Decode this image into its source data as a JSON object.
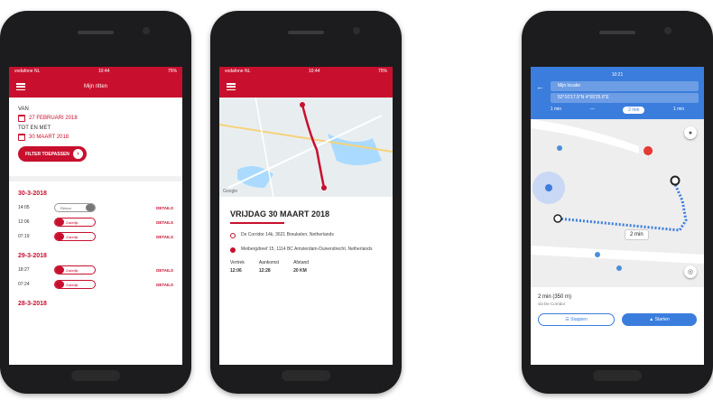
{
  "colors": {
    "brand_red": "#c8102e",
    "google_blue": "#3b7ddd"
  },
  "screen1": {
    "status_left": "vodafone NL",
    "status_time": "10:44",
    "status_right": "75%",
    "title": "Mijn ritten",
    "from_label": "VAN",
    "from_date": "27 FEBRUARI 2018",
    "to_label": "TOT EN MET",
    "to_date": "30 MAART 2018",
    "filter_button": "FILTER TOEPASSEN",
    "groups": [
      {
        "date": "30-3-2018",
        "rows": [
          {
            "time": "14:05",
            "toggle": "Retour",
            "detail": "DETAILS"
          },
          {
            "time": "12:06",
            "toggle": "Zakelijk",
            "detail": "DETAILS"
          },
          {
            "time": "07:19",
            "toggle": "Zakelijk",
            "detail": "DETAILS"
          }
        ]
      },
      {
        "date": "29-3-2018",
        "rows": [
          {
            "time": "18:27",
            "toggle": "Zakelijk",
            "detail": "DETAILS"
          },
          {
            "time": "07:24",
            "toggle": "Zakelijk",
            "detail": "DETAILS"
          }
        ]
      },
      {
        "date": "28-3-2018",
        "rows": []
      }
    ]
  },
  "screen2": {
    "status_left": "vodafone NL",
    "status_time": "10:44",
    "status_right": "75%",
    "map_brand": "Google",
    "heading": "VRIJDAG 30 MAART 2018",
    "from_address": "De Corridor 14k, 3621 Breukelen, Netherlands",
    "to_address": "Meibergdreef 15, 1114 BC Amsterdam-Duivendrecht, Netherlands",
    "stats": [
      {
        "label": "Vertrek",
        "value": "12:06"
      },
      {
        "label": "Aankomst",
        "value": "12:28"
      },
      {
        "label": "Afstand",
        "value": "20 KM"
      }
    ]
  },
  "screen3": {
    "status_time": "10:21",
    "origin": "Mijn locatie",
    "destination": "52°10'17.9\"N 4°59'25.6\"E",
    "modes": [
      "1 min",
      "—",
      "2 min",
      "1 min"
    ],
    "eta_bubble": "2 min",
    "summary": "2 min (350 m)",
    "summary_sub": "via De Corridor",
    "btn_steps": "Stappen",
    "btn_start": "Starten"
  }
}
